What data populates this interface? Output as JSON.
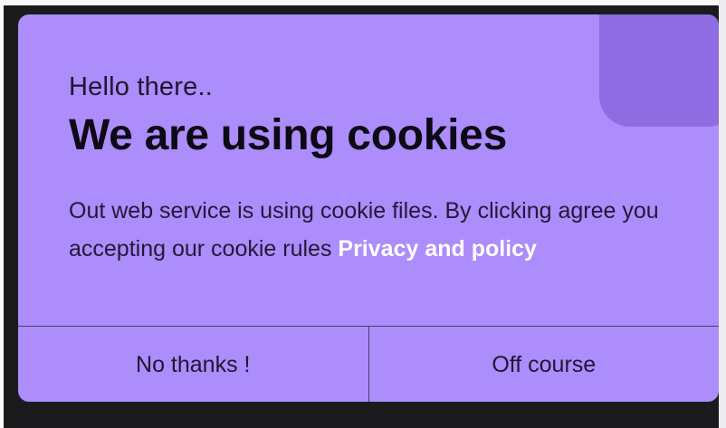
{
  "dialog": {
    "greeting": "Hello there..",
    "title": "We are using cookies",
    "message": "Out web service is using cookie files. By clicking agree you accepting our cookie rules",
    "privacy_link": "Privacy and policy"
  },
  "buttons": {
    "decline_label": "No thanks !",
    "accept_label": "Off course"
  },
  "colors": {
    "card_background": "#ad8cfb",
    "corner_accent": "#8f6ce2",
    "page_background": "#1b1b1d",
    "link": "#ffffff"
  }
}
